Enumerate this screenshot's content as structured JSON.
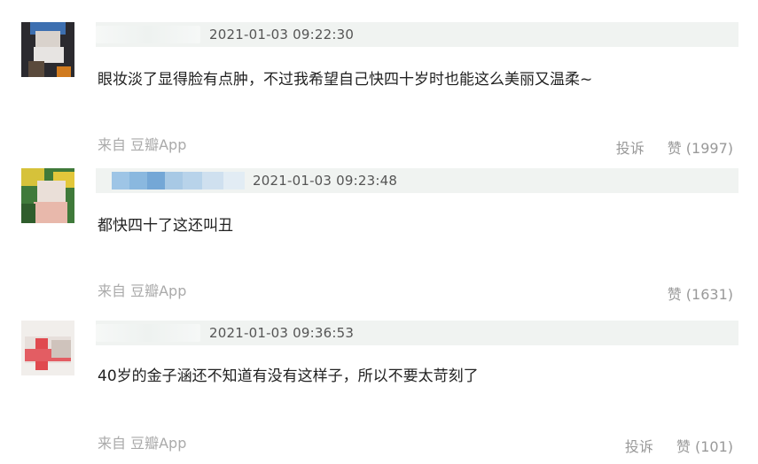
{
  "comments": [
    {
      "time": "2021-01-03 09:22:30",
      "text": "眼妆淡了显得脸有点肿，不过我希望自己快四十岁时也能这么美丽又温柔~",
      "source": "来自 豆瓣App",
      "report": "投诉",
      "like": "赞 (1997)"
    },
    {
      "time": "2021-01-03 09:23:48",
      "text": "都快四十了这还叫丑",
      "source": "来自 豆瓣App",
      "like": "赞 (1631)"
    },
    {
      "time": "2021-01-03 09:36:53",
      "text": "40岁的金子涵还不知道有没有这样子，所以不要太苛刻了",
      "source": "来自 豆瓣App",
      "report": "投诉",
      "like": "赞 (101)"
    }
  ]
}
